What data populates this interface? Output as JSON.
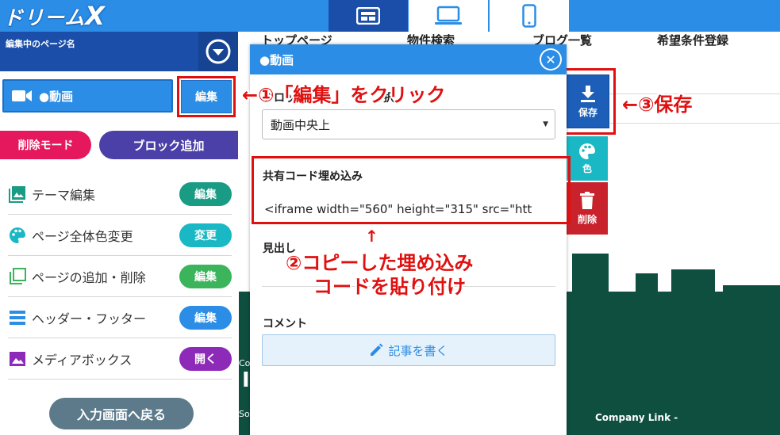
{
  "app": {
    "logo_text": "ドリーム",
    "logo_x": "X"
  },
  "device_switch": [
    "tablet-icon",
    "laptop-icon",
    "phone-icon"
  ],
  "left": {
    "page_name_label": "編集中のページ名",
    "video_block_label": "●動画",
    "edit_label": "編集",
    "delete_mode_label": "削除モード",
    "add_block_label": "ブロック追加",
    "menu": [
      {
        "label": "テーマ編集",
        "button": "編集",
        "color": "#1a9b84",
        "icon": "image-icon"
      },
      {
        "label": "ページ全体色変更",
        "button": "変更",
        "color": "#1ab8c4",
        "icon": "palette-icon"
      },
      {
        "label": "ページの追加・削除",
        "button": "編集",
        "color": "#3cb45b",
        "icon": "pages-icon"
      },
      {
        "label": "ヘッダー・フッター",
        "button": "編集",
        "color": "#2b8de6",
        "icon": "header-footer-icon"
      },
      {
        "label": "メディアボックス",
        "button": "開く",
        "color": "#8e2ab8",
        "icon": "media-icon"
      }
    ],
    "back_label": "入力画面へ戻る"
  },
  "preview": {
    "nav": [
      "トップページ",
      "物件検索",
      "ブログ一覧",
      "希望条件登録"
    ],
    "hero_co": "Co",
    "hero_big": "I",
    "hero_so": "So",
    "company_link": "Company Link -"
  },
  "side_buttons": {
    "save": "保存",
    "color": "色",
    "delete": "削除"
  },
  "modal": {
    "title": "●動画",
    "layout_label_partial": "ブロック",
    "layout_label_tail": "択",
    "layout_value": "動画中央上",
    "share_label": "共有コード埋め込み",
    "share_value": "<iframe width=\"560\" height=\"315\" src=\"htt",
    "heading_label": "見出し",
    "comment_label": "コメント",
    "write_label": "記事を書く"
  },
  "annotations": {
    "step1": "←①「編集」をクリック",
    "step2_line1": "②コピーした埋め込み",
    "step2_line2": "コードを貼り付け",
    "step3": "←③保存",
    "arrow_up": "↑"
  },
  "colors": {
    "primary": "#2b8de6",
    "dark_blue": "#1b4ea8",
    "annotation_red": "#e01010",
    "hero_green": "#0e4f3f"
  }
}
